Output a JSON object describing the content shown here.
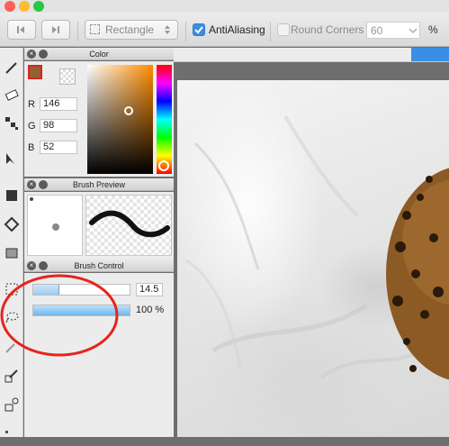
{
  "toolbar": {
    "shape_select": "Rectangle",
    "antialiasing_label": "AntiAliasing",
    "antialiasing_checked": true,
    "round_corners_label": "Round Corners",
    "round_corners_checked": false,
    "round_corners_value": "60",
    "percent_label": "%"
  },
  "color_panel": {
    "title": "Color",
    "r_label": "R",
    "r_value": "146",
    "g_label": "G",
    "g_value": "98",
    "b_label": "B",
    "b_value": "52",
    "current_color": "#926234"
  },
  "brush_preview_panel": {
    "title": "Brush Preview"
  },
  "brush_control_panel": {
    "title": "Brush Control",
    "size_value": "14.5",
    "size_fraction": 0.27,
    "opacity_value": "100 %",
    "opacity_fraction": 1.0
  },
  "accent_color": "#3a8ee6"
}
